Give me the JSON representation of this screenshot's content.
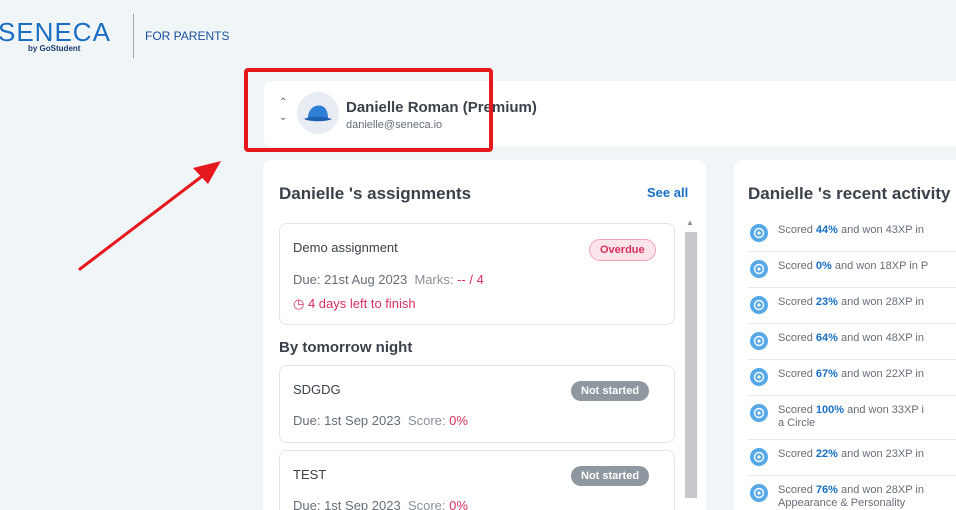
{
  "header": {
    "logo_text": "SENECA",
    "logo_sub": "by GoStudent",
    "section": "FOR PARENTS"
  },
  "student": {
    "name": "Danielle Roman (Premium)",
    "email": "danielle@seneca.io"
  },
  "assignments": {
    "title": "Danielle 's assignments",
    "see_all": "See all",
    "items": [
      {
        "title": "Demo assignment",
        "status": "Overdue",
        "due_label": "Due: ",
        "due": "21st Aug 2023",
        "marks_label": "Marks: ",
        "marks": "-- / 4",
        "days_left": "4 days left to finish"
      }
    ],
    "section_title": "By tomorrow night",
    "upcoming": [
      {
        "title": "SDGDG",
        "status": "Not started",
        "due_label": "Due: ",
        "due": "1st Sep 2023",
        "score_label": "Score: ",
        "score": "0%"
      },
      {
        "title": "TEST",
        "status": "Not started",
        "due_label": "Due: ",
        "due": "1st Sep 2023",
        "score_label": "Score: ",
        "score": "0%"
      }
    ]
  },
  "activity": {
    "title": "Danielle 's recent activity",
    "items": [
      {
        "pre": "Scored ",
        "score": "44%",
        "post": " and won 43XP in",
        "line2": ""
      },
      {
        "pre": "Scored ",
        "score": "0%",
        "post": " and won 18XP in P",
        "line2": ""
      },
      {
        "pre": "Scored ",
        "score": "23%",
        "post": " and won 28XP in",
        "line2": ""
      },
      {
        "pre": "Scored ",
        "score": "64%",
        "post": " and won 48XP in",
        "line2": ""
      },
      {
        "pre": "Scored ",
        "score": "67%",
        "post": " and won 22XP in",
        "line2": ""
      },
      {
        "pre": "Scored ",
        "score": "100%",
        "post": " and won 33XP i",
        "line2": "a Circle"
      },
      {
        "pre": "Scored ",
        "score": "22%",
        "post": " and won 23XP in",
        "line2": ""
      },
      {
        "pre": "Scored ",
        "score": "76%",
        "post": " and won 28XP in",
        "line2": "Appearance & Personality"
      }
    ]
  },
  "colors": {
    "brand_blue": "#1a6fc2",
    "annotation_red": "#e5181e",
    "overdue_pink": "#d6305c"
  }
}
